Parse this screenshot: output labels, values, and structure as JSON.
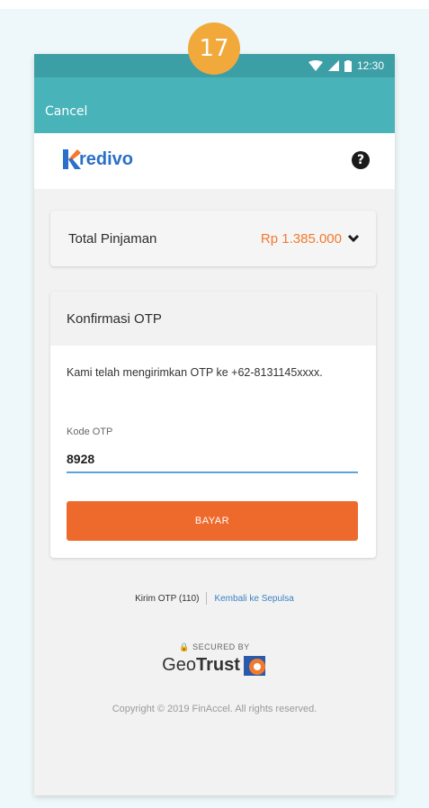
{
  "step_badge": "17",
  "status_bar": {
    "time": "12:30"
  },
  "header": {
    "cancel_label": "Cancel"
  },
  "brand": {
    "logo_text": "redivo"
  },
  "total": {
    "label": "Total Pinjaman",
    "amount": "Rp 1.385.000"
  },
  "otp": {
    "title": "Konfirmasi OTP",
    "message": "Kami telah mengirimkan OTP ke +62-8131145xxxx.",
    "field_label": "Kode OTP",
    "value": "8928",
    "submit_label": "BAYAR"
  },
  "footer": {
    "resend_label": "Kirim OTP (110)",
    "back_link": "Kembali ke Sepulsa",
    "secured_label": "SECURED BY",
    "geotrust_text_light": "Geo",
    "geotrust_text_bold": "Trust",
    "copyright": "Copyright © 2019 FinAccel. All rights reserved."
  },
  "colors": {
    "header_teal": "#49b3ba",
    "accent_orange": "#ee6a2c",
    "amount_orange": "#f27a2c",
    "brand_blue": "#2a6fc9",
    "link_blue": "#3b82c4"
  },
  "icons": [
    "wifi-icon",
    "signal-icon",
    "battery-icon",
    "help-icon",
    "chevron-down-icon",
    "lock-icon",
    "geotrust-logo-icon"
  ]
}
